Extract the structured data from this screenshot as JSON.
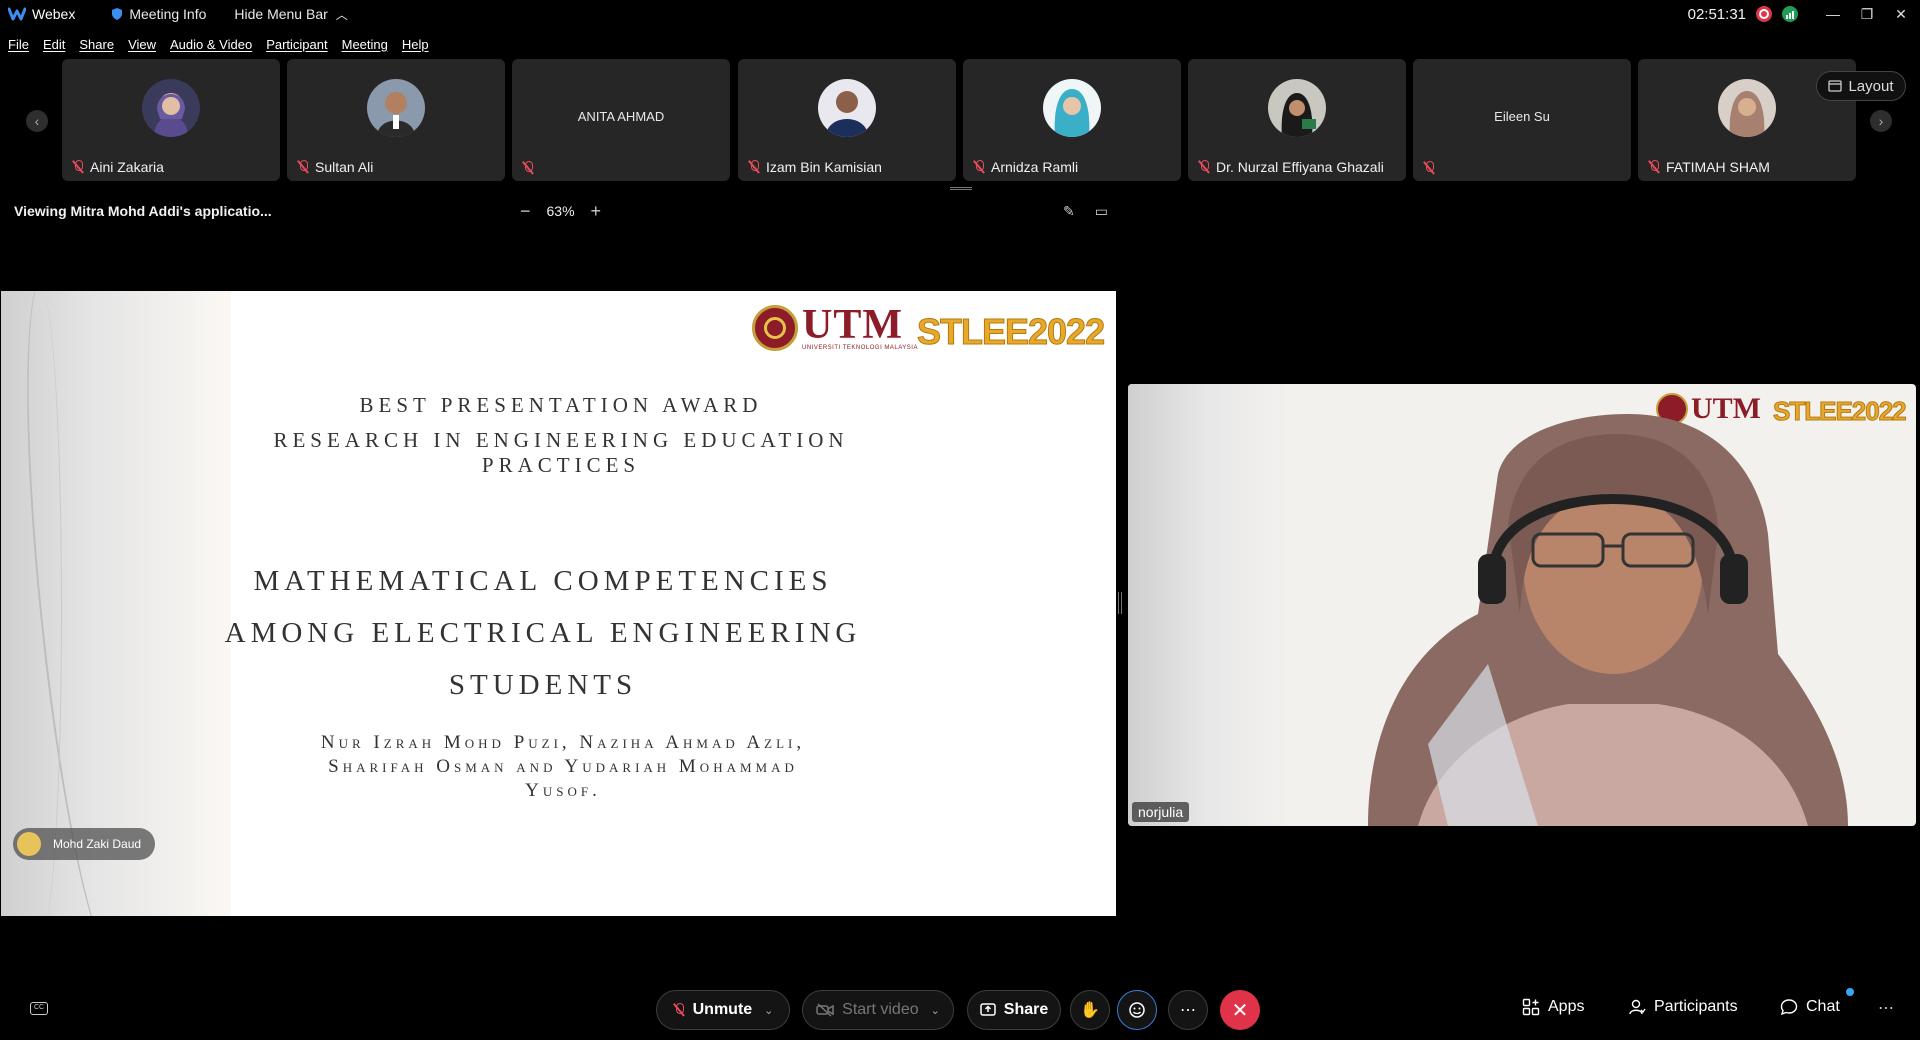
{
  "titlebar": {
    "app_name": "Webex",
    "meeting_info": "Meeting Info",
    "hide_menu": "Hide Menu Bar",
    "clock": "02:51:31"
  },
  "menu": [
    "File",
    "Edit",
    "Share",
    "View",
    "Audio & Video",
    "Participant",
    "Meeting",
    "Help"
  ],
  "participants": [
    {
      "name": "Aini Zakaria",
      "avatar": true,
      "avatar_color": "#5a4a6e"
    },
    {
      "name": "Sultan Ali",
      "avatar": true,
      "avatar_color": "#6c7a8c"
    },
    {
      "name": "",
      "center_name": "ANITA AHMAD",
      "avatar": false
    },
    {
      "name": "Izam Bin Kamisian",
      "avatar": true,
      "avatar_color": "#2a3e6a"
    },
    {
      "name": "Arnidza Ramli",
      "avatar": true,
      "avatar_color": "#3ab0c8"
    },
    {
      "name": "Dr. Nurzal Effiyana Ghazali",
      "avatar": true,
      "avatar_color": "#4a4a4a"
    },
    {
      "name": "",
      "center_name": "Eileen Su",
      "avatar": false
    },
    {
      "name": "FATIMAH SHAM",
      "avatar": true,
      "avatar_color": "#a88a7a"
    }
  ],
  "layout_label": "Layout",
  "sharebar": {
    "viewing": "Viewing Mitra Mohd Addi's applicatio...",
    "zoom": "63%"
  },
  "slide": {
    "utm": "UTM",
    "utm_sub": "UNIVERSITI TEKNOLOGI MALAYSIA",
    "stlee": "STLEE2022",
    "award": "Best Presentation Award",
    "category": "Research in Engineering Education Practices",
    "title_lines": [
      "Mathematical Competencies",
      "among Electrical Engineering",
      "Students"
    ],
    "authors": [
      "Nur Izrah Mohd Puzi, Naziha Ahmad Azli,",
      "Sharifah Osman and Yudariah Mohammad",
      "Yusof."
    ],
    "speaker": "Mohd Zaki Daud"
  },
  "video": {
    "name": "norjulia",
    "utm": "UTM",
    "stlee": "STLEE2022"
  },
  "controls": {
    "unmute": "Unmute",
    "start_video": "Start video",
    "share": "Share",
    "apps": "Apps",
    "participants": "Participants",
    "chat": "Chat"
  },
  "colors": {
    "end_call": "#e0334a",
    "muted": "#e74c5b",
    "utm_maroon": "#8b1c28",
    "stlee_gold": "#e8a92a"
  }
}
